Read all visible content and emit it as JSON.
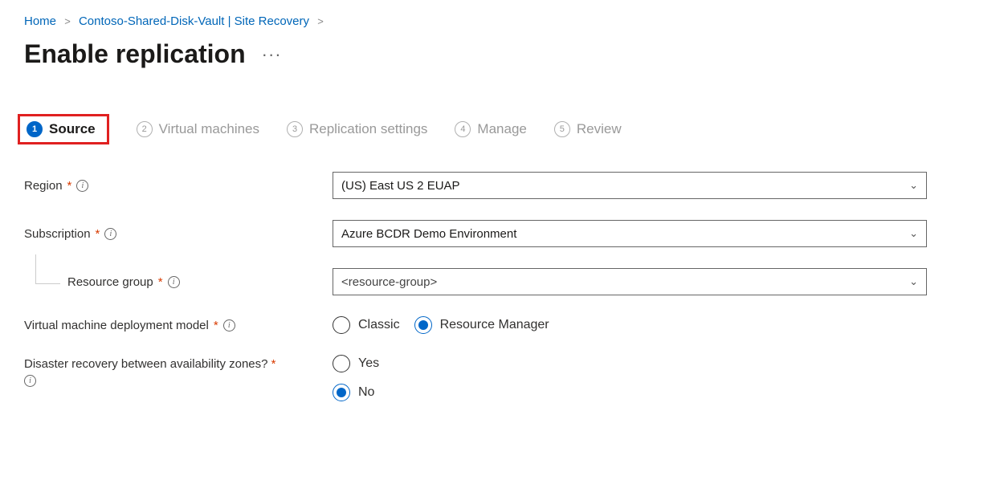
{
  "breadcrumb": {
    "home": "Home",
    "vault": "Contoso-Shared-Disk-Vault | Site Recovery"
  },
  "page": {
    "title": "Enable replication"
  },
  "steps": [
    {
      "num": "1",
      "label": "Source",
      "active": true
    },
    {
      "num": "2",
      "label": "Virtual machines",
      "active": false
    },
    {
      "num": "3",
      "label": "Replication settings",
      "active": false
    },
    {
      "num": "4",
      "label": "Manage",
      "active": false
    },
    {
      "num": "5",
      "label": "Review",
      "active": false
    }
  ],
  "form": {
    "region_label": "Region",
    "region_value": "(US) East US 2 EUAP",
    "subscription_label": "Subscription",
    "subscription_value": "Azure BCDR Demo Environment",
    "resource_group_label": "Resource group",
    "resource_group_value": "<resource-group>",
    "deploy_model_label": "Virtual machine deployment model",
    "deploy_model_options": {
      "classic": "Classic",
      "rm": "Resource Manager"
    },
    "deploy_model_selected": "rm",
    "dr_zones_label": "Disaster recovery between availability zones?",
    "dr_zones_options": {
      "yes": "Yes",
      "no": "No"
    },
    "dr_zones_selected": "no"
  }
}
